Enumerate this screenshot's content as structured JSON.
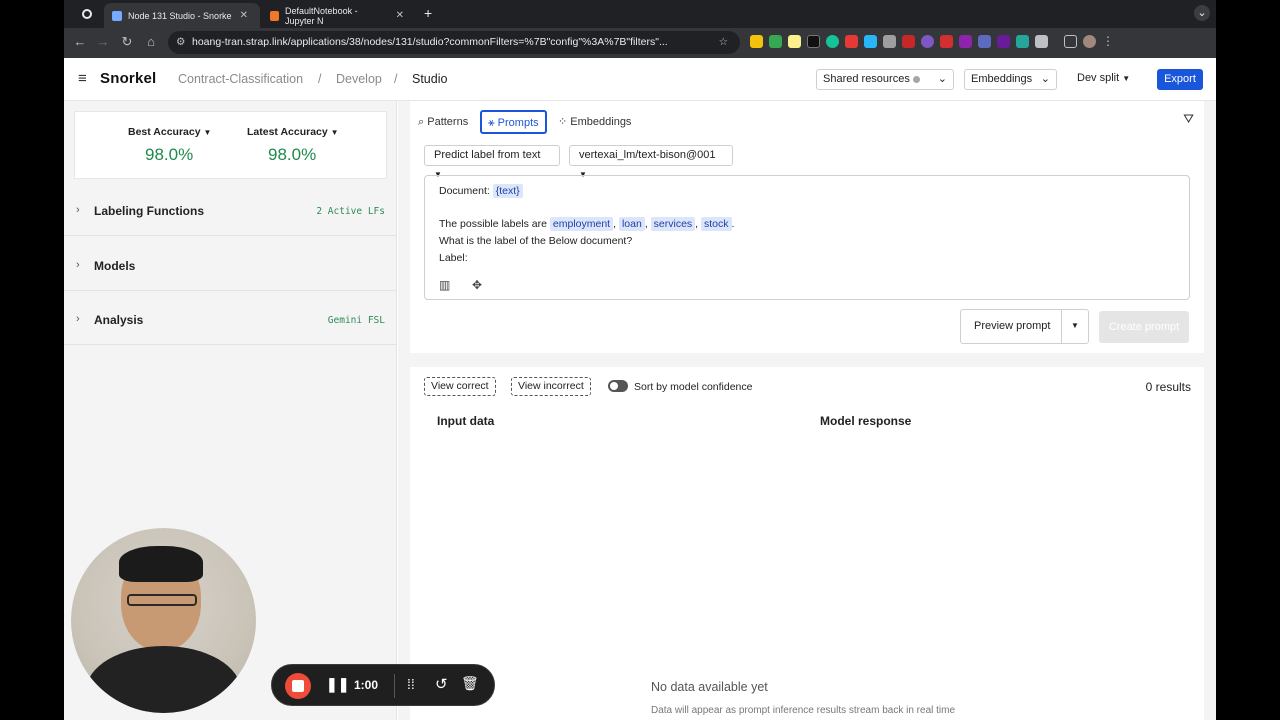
{
  "browser": {
    "tabs": [
      {
        "title": "Node 131 Studio - Snorke",
        "active": true
      },
      {
        "title": "DefaultNotebook - Jupyter N",
        "active": false
      }
    ],
    "url": "hoang-tran.strap.link/applications/38/nodes/131/studio?commonFilters=%7B\"config\"%3A%7B\"filters\"..."
  },
  "header": {
    "logo": "Snorkel",
    "breadcrumb": [
      "Contract-Classification",
      "/",
      "Develop",
      "/",
      "Studio"
    ],
    "shared_resources": "Shared resources",
    "embeddings": "Embeddings",
    "split": "Dev split",
    "export": "Export"
  },
  "left": {
    "best_label": "Best Accuracy",
    "best_value": "98.0%",
    "latest_label": "Latest Accuracy",
    "latest_value": "98.0%",
    "sections": [
      {
        "title": "Labeling Functions",
        "meta": "2 Active LFs"
      },
      {
        "title": "Models",
        "meta": ""
      },
      {
        "title": "Analysis",
        "meta": "Gemini FSL"
      }
    ]
  },
  "right": {
    "tabs": [
      "Patterns",
      "Prompts",
      "Embeddings"
    ],
    "task_dropdown": "Predict label from text",
    "model_dropdown": "vertexai_lm/text-bison@001",
    "prompt": {
      "doc_label": "Document:",
      "doc_var": "{text}",
      "labels_prefix": "The possible labels are",
      "labels": [
        "employment",
        "loan",
        "services",
        "stock"
      ],
      "question": "What is the label of the Below document?",
      "answer": "Label:"
    },
    "preview": "Preview prompt",
    "create": "Create prompt",
    "view_correct": "View correct",
    "view_incorrect": "View incorrect",
    "sort_label": "Sort by model confidence",
    "results_count": "0 results",
    "col_input": "Input data",
    "col_response": "Model response",
    "empty_title": "No data available yet",
    "empty_sub": "Data will appear as prompt inference results stream back in real time"
  },
  "recorder": {
    "time": "1:00"
  }
}
